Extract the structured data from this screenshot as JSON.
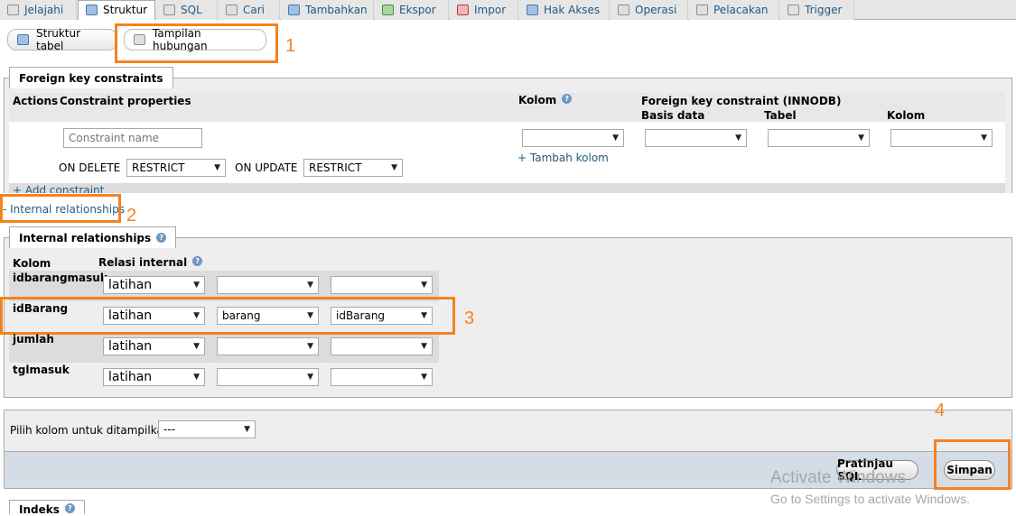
{
  "top_tabs": [
    "Jelajahi",
    "Struktur",
    "SQL",
    "Cari",
    "Tambahkan",
    "Ekspor",
    "Impor",
    "Hak Akses",
    "Operasi",
    "Pelacakan",
    "Trigger"
  ],
  "sub_tabs": {
    "structure": "Struktur tabel",
    "relation_view": "Tampilan hubungan"
  },
  "foreign_key": {
    "legend": "Foreign key constraints",
    "col_actions": "Actions",
    "col_constraint_props": "Constraint properties",
    "col_kolom": "Kolom",
    "col_fk_innodb": "Foreign key constraint (INNODB)",
    "col_basis_data": "Basis data",
    "col_tabel": "Tabel",
    "col_kolom2": "Kolom",
    "constraint_placeholder": "Constraint name",
    "on_delete_label": "ON DELETE",
    "on_delete_value": "RESTRICT",
    "on_update_label": "ON UPDATE",
    "on_update_value": "RESTRICT",
    "add_column": "+ Tambah kolom",
    "add_constraint": "+ Add constraint"
  },
  "internal_link": "- Internal relationships",
  "internal": {
    "legend": "Internal relationships",
    "col_kolom": "Kolom",
    "col_relasi": "Relasi internal",
    "rows": [
      {
        "name": "idbarangmasuk",
        "db": "latihan",
        "table": "",
        "column": ""
      },
      {
        "name": "idBarang",
        "db": "latihan",
        "table": "barang",
        "column": "idBarang"
      },
      {
        "name": "jumlah",
        "db": "latihan",
        "table": "",
        "column": ""
      },
      {
        "name": "tglmasuk",
        "db": "latihan",
        "table": "",
        "column": ""
      }
    ]
  },
  "display_column": {
    "label": "Pilih kolom untuk ditampilkan:",
    "value": "---"
  },
  "buttons": {
    "preview_sql": "Pratinjau SQL",
    "save": "Simpan"
  },
  "indexes_legend": "Indeks",
  "annotations": [
    "1",
    "2",
    "3",
    "4"
  ],
  "watermark": {
    "line1": "Activate Windows",
    "line2": "Go to Settings to activate Windows."
  },
  "colors": {
    "annotation": "#f5821f",
    "link": "#235a81",
    "panel": "#eeeeee"
  },
  "icons": {
    "top_tabs": [
      "browse-icon",
      "structure-icon",
      "sql-icon",
      "search-icon",
      "insert-icon",
      "export-icon",
      "import-icon",
      "privileges-icon",
      "operations-icon",
      "tracking-icon",
      "trigger-icon"
    ],
    "sub_tabs": [
      "table-structure-icon",
      "relation-view-icon"
    ],
    "help": "help-icon"
  }
}
